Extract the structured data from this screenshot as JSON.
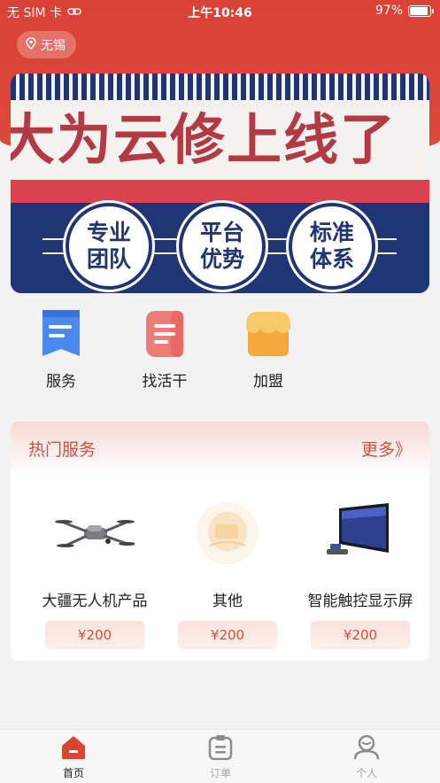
{
  "status_bar": {
    "carrier": "无 SIM 卡",
    "time": "上午10:46",
    "battery": "97%",
    "battery_level": 0.97
  },
  "location": {
    "city": "无锡"
  },
  "banner": {
    "title": "大为云修上线了",
    "badges": [
      {
        "line1": "专业",
        "line2": "团队"
      },
      {
        "line1": "平台",
        "line2": "优势"
      },
      {
        "line1": "标准",
        "line2": "体系"
      }
    ]
  },
  "quick_actions": [
    {
      "label": "服务",
      "icon": "service-icon",
      "color": "#4a8af0"
    },
    {
      "label": "找活干",
      "icon": "find-work-icon",
      "color": "#ee7b76"
    },
    {
      "label": "加盟",
      "icon": "store-icon",
      "color": "#f5b84a"
    }
  ],
  "hot_services": {
    "title": "热门服务",
    "more": "更多》",
    "items": [
      {
        "name": "大疆无人机产品",
        "price": "¥200",
        "icon": "drone-image"
      },
      {
        "name": "其他",
        "price": "¥200",
        "icon": "other-placeholder-image"
      },
      {
        "name": "智能触控显示屏",
        "price": "¥200",
        "icon": "touch-display-image"
      }
    ]
  },
  "tab_bar": {
    "tabs": [
      {
        "label": "首页",
        "icon": "home-icon",
        "active": true
      },
      {
        "label": "订单",
        "icon": "clipboard-icon",
        "active": false
      },
      {
        "label": "个人",
        "icon": "person-icon",
        "active": false
      }
    ]
  },
  "colors": {
    "brand_red": "#da4236",
    "accent_text": "#d0503f",
    "tab_inactive": "#a6a6a6"
  }
}
